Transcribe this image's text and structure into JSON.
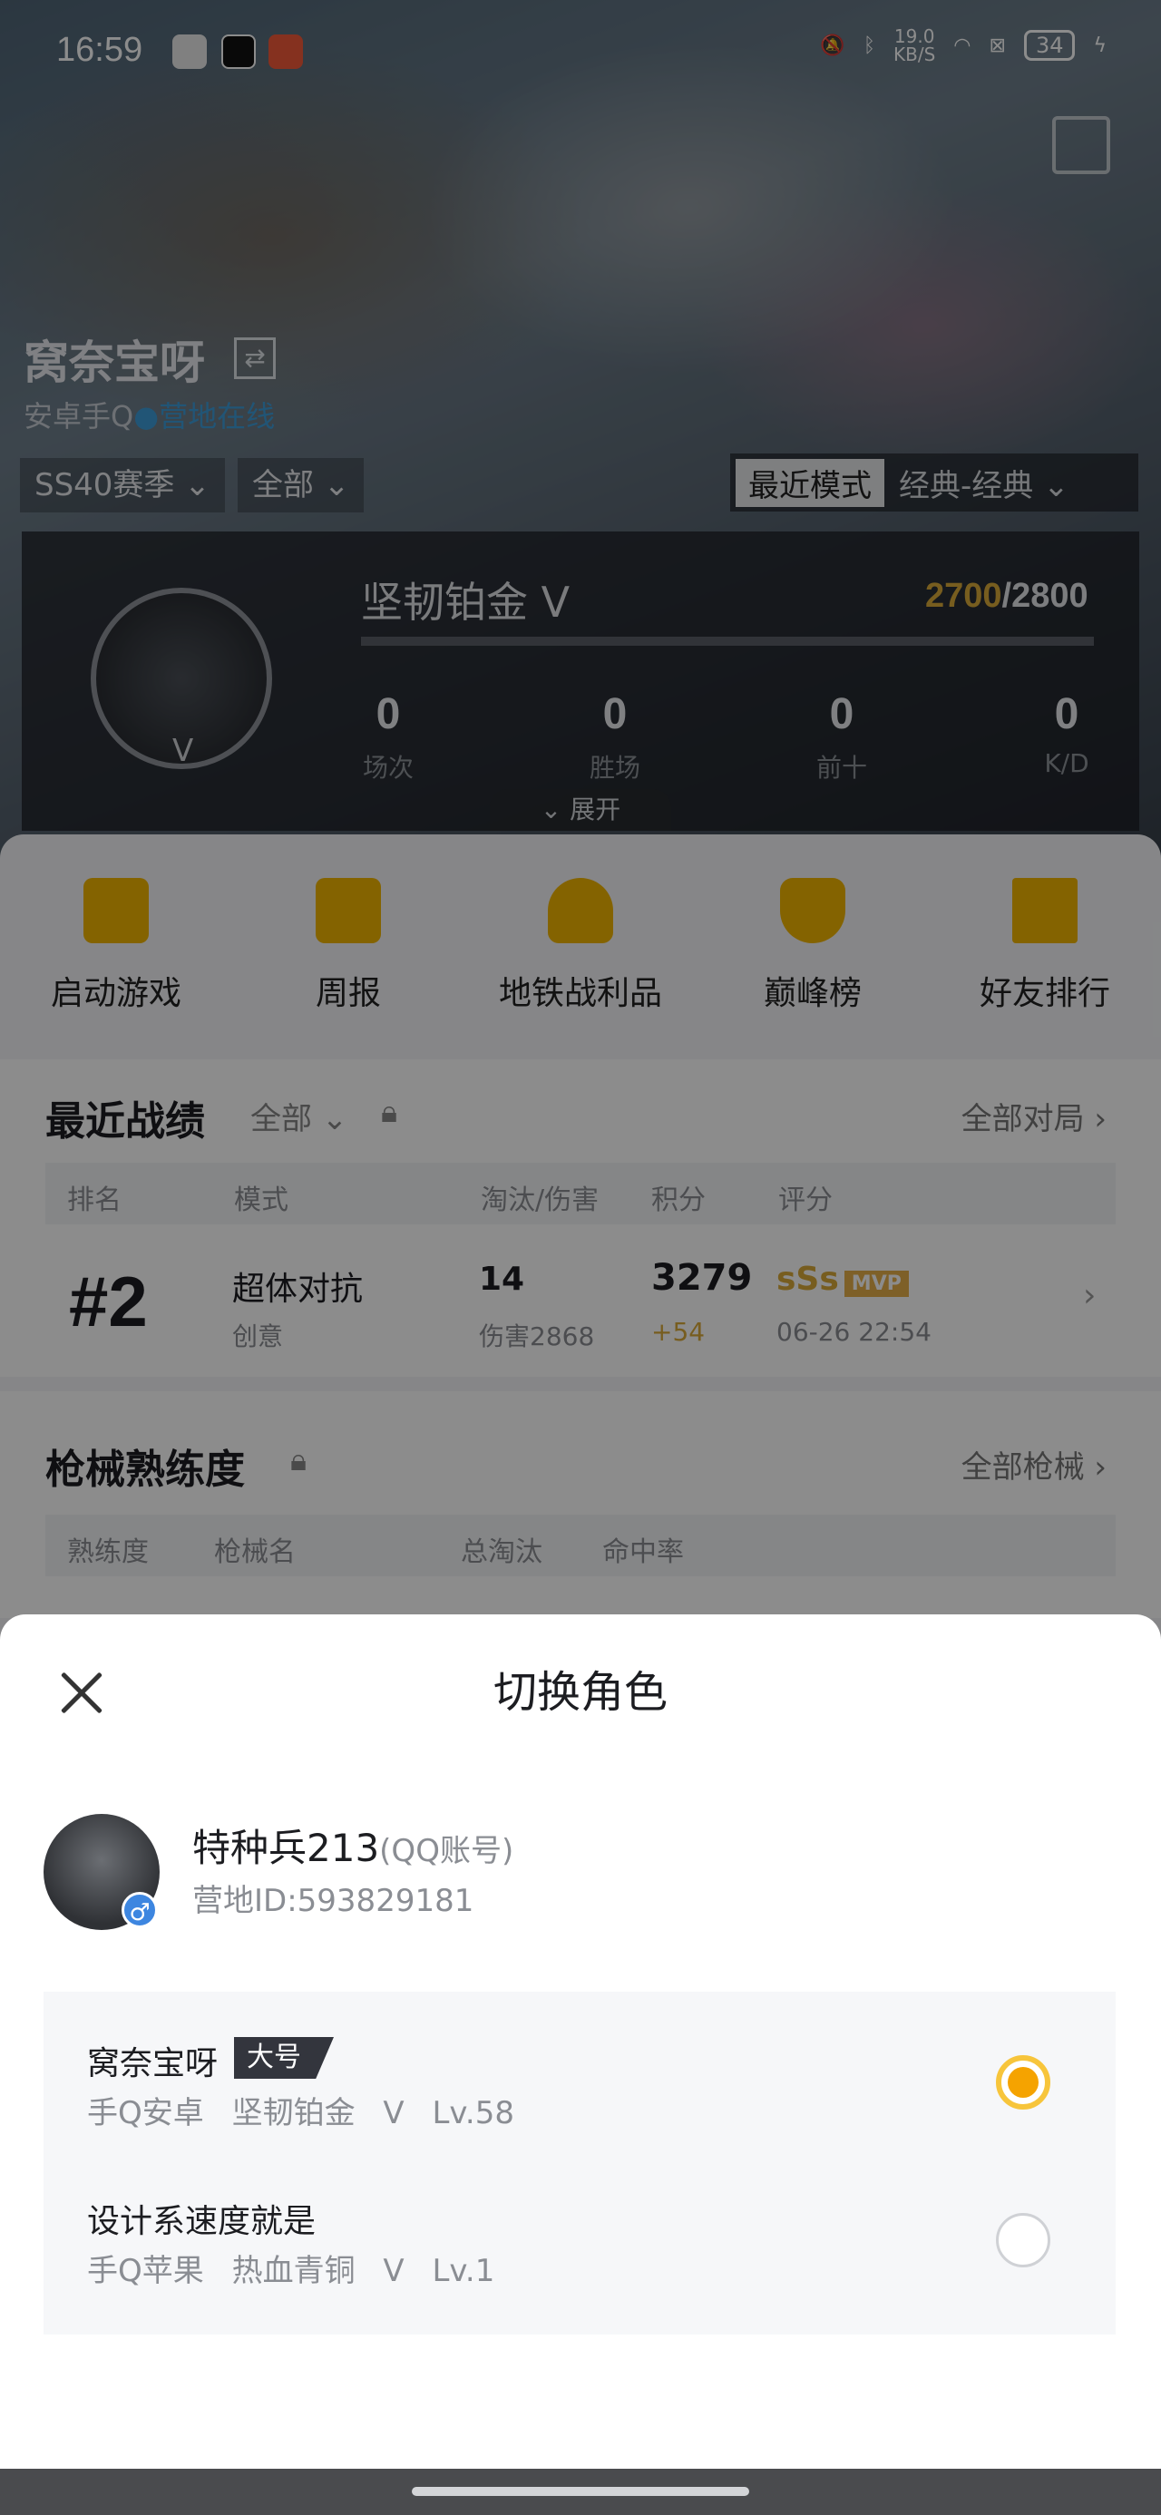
{
  "status_bar": {
    "time": "16:59",
    "net_speed": "19.0",
    "net_unit": "KB/S",
    "battery": "34"
  },
  "profile": {
    "name": "窝奈宝呀",
    "swap_icon": "⇄",
    "platform": "安卓手Q",
    "online_status": "营地在线",
    "season_filter": "SS40赛季",
    "scope_filter": "全部",
    "mode_active": "最近模式",
    "mode_other": "经典-经典"
  },
  "rank_card": {
    "tier": "坚韧铂金 Ⅴ",
    "points_current": "2700",
    "points_total": "/2800",
    "points_progress": 0.0,
    "emblem_level": "Ⅴ",
    "stats": [
      {
        "value": "0",
        "label": "场次"
      },
      {
        "value": "0",
        "label": "胜场"
      },
      {
        "value": "0",
        "label": "前十"
      },
      {
        "value": "0",
        "label": "K/D"
      }
    ],
    "expand_label": "展开"
  },
  "quick_actions": [
    {
      "label": "启动游戏",
      "icon": "lightning-icon"
    },
    {
      "label": "周报",
      "icon": "calendar-icon"
    },
    {
      "label": "地铁战利品",
      "icon": "shield-badge-icon"
    },
    {
      "label": "巅峰榜",
      "icon": "trophy-icon"
    },
    {
      "label": "好友排行",
      "icon": "podium-icon"
    }
  ],
  "recent_matches": {
    "title": "最近战绩",
    "filter": "全部",
    "all_link": "全部对局",
    "headers": [
      "排名",
      "模式",
      "淘汰/伤害",
      "积分",
      "评分"
    ],
    "row": {
      "rank": "#2",
      "mode": "超体对抗",
      "submode": "创意",
      "kills": "14",
      "damage": "伤害2868",
      "score": "3279",
      "score_delta": "+54",
      "grade": "sSs",
      "mvp": "MVP",
      "time": "06-26 22:54"
    }
  },
  "weapon_mastery": {
    "title": "枪械熟练度",
    "all_link": "全部枪械",
    "headers": [
      "熟练度",
      "枪械名",
      "总淘汰",
      "命中率"
    ]
  },
  "sheet": {
    "title": "切换角色",
    "account_name": "特种兵213",
    "account_type": "(QQ账号)",
    "camp_id": "营地ID:593829181",
    "gender_symbol": "♂",
    "roles": [
      {
        "name": "窝奈宝呀",
        "badge": "大号",
        "platform": "手Q安卓",
        "tier": "坚韧铂金 Ⅴ",
        "level": "Lv.58",
        "selected": true
      },
      {
        "name": "设计系速度就是",
        "badge": "",
        "platform": "手Q苹果",
        "tier": "热血青铜 Ⅴ",
        "level": "Lv.1",
        "selected": false
      }
    ]
  },
  "colors": {
    "accent": "#f5a300",
    "online": "#3d9cd8",
    "gold": "#d9a93a"
  }
}
